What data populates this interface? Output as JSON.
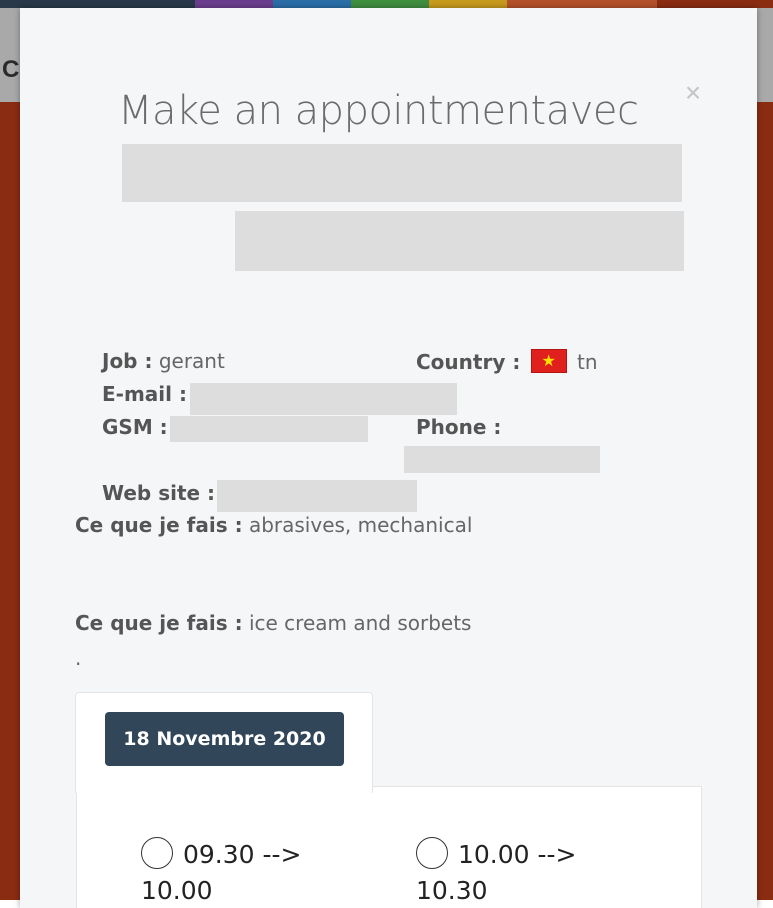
{
  "background": {
    "header_text": "C",
    "stripe_colors": [
      "#29394a",
      "#6b3f8e",
      "#2a6ea8",
      "#3f8e3f",
      "#c79a1d",
      "#b5512a",
      "#8a2c12"
    ]
  },
  "modal": {
    "title": "Make an appointmentavec",
    "close_label": "×",
    "job_label": "Job :",
    "job_value": "gerant",
    "country_label": "Country :",
    "country_value": "tn",
    "email_label": "E-mail :",
    "gsm_label": "GSM :",
    "phone_label": "Phone :",
    "website_label": "Web site :",
    "activity1_label": "Ce que je fais :",
    "activity1_value": "abrasives, mechanical",
    "activity2_label": "Ce que je fais :",
    "activity2_value": "ice cream and sorbets",
    "dot": ".",
    "tabs": [
      {
        "label": "18 Novembre 2020"
      }
    ],
    "slots": [
      {
        "line1": "09.30 -->",
        "line2": "10.00"
      },
      {
        "line1": "10.00 -->",
        "line2": "10.30"
      }
    ]
  }
}
